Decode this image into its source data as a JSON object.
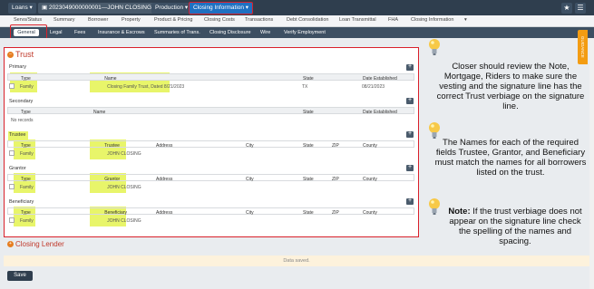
{
  "topbar": {
    "loans": "Loans",
    "loan_number": "2023049000000001—JOHN CLOSING",
    "production": "Production",
    "closing_information": "Closing Information"
  },
  "tabs_primary": [
    "Servs/Status",
    "Summary",
    "Borrower",
    "Property",
    "Product & Pricing",
    "Closing Costs",
    "Transactions",
    "Debt Consolidation",
    "Loan Transmittal",
    "FHA",
    "Closing Information"
  ],
  "tabs_secondary": [
    "General",
    "Legal",
    "Fees",
    "Insurance & Escrows",
    "Summaries of Trans.",
    "Closing Disclosure",
    "Wire",
    "Verify Employment"
  ],
  "right_tab": "GUIDANCE",
  "trust": {
    "title": "Trust",
    "primary": {
      "label": "Primary",
      "headers": [
        "Type",
        "Name",
        "State",
        "Date Established"
      ],
      "row": {
        "type": "Family",
        "name": "Closing Family Trust, Dated 8/21/2023",
        "state": "TX",
        "date": "08/21/2023"
      }
    },
    "secondary": {
      "label": "Secondary",
      "headers": [
        "Type",
        "Name",
        "State",
        "Date Established"
      ],
      "empty": "No records"
    },
    "trustee": {
      "label": "Trustee",
      "headers": [
        "Type",
        "Trustee",
        "Address",
        "City",
        "State",
        "ZIP",
        "County"
      ],
      "row": {
        "type": "Family",
        "name": "JOHN CLOSING"
      }
    },
    "grantor": {
      "label": "Grantor",
      "headers": [
        "Type",
        "Grantor",
        "Address",
        "City",
        "State",
        "ZIP",
        "County"
      ],
      "row": {
        "type": "Family",
        "name": "JOHN CLOSING"
      }
    },
    "beneficiary": {
      "label": "Beneficiary",
      "headers": [
        "Type",
        "Beneficiary",
        "Address",
        "City",
        "State",
        "ZIP",
        "County"
      ],
      "row": {
        "type": "Family",
        "name": "JOHN CLOSING"
      }
    }
  },
  "closing_lender": "Closing Lender",
  "status": "Data saved.",
  "save": "Save",
  "notes": {
    "note1": "Closer should review the Note, Mortgage, Riders to make sure the vesting and the signature line has the correct Trust verbiage on the signature line.",
    "note2": "The Names for each of the required fields Trustee, Grantor, and Beneficiary must match the names for all borrowers listed on the trust.",
    "note3_bold": "Note:",
    "note3": " If the trust verbiage does not appear on the signature line check the spelling of the names and spacing."
  },
  "colors": {
    "accent": "#d9202a",
    "highlight": "#e8f56a",
    "nav": "#2f3e4e"
  }
}
